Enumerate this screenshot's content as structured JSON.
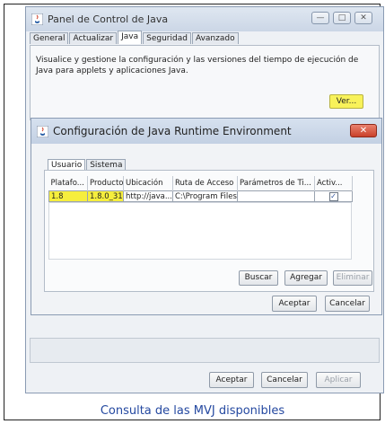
{
  "window": {
    "title": "Panel de Control de Java",
    "minimize": "—",
    "maximize": "□",
    "close": "✕"
  },
  "tabs": [
    {
      "label": "General",
      "active": false
    },
    {
      "label": "Actualizar",
      "active": false
    },
    {
      "label": "Java",
      "active": true
    },
    {
      "label": "Seguridad",
      "active": false
    },
    {
      "label": "Avanzado",
      "active": false
    }
  ],
  "java_panel": {
    "description": "Visualice y gestione la configuración y las versiones del tiempo de ejecución de Java para applets y aplicaciones Java.",
    "view_button": "Ver..."
  },
  "dialog": {
    "title": "Configuración de Java Runtime Environment",
    "close": "✕",
    "tabs": [
      {
        "label": "Usuario",
        "active": true
      },
      {
        "label": "Sistema",
        "active": false
      }
    ],
    "columns": [
      "Platafo...",
      "Producto",
      "Ubicación",
      "Ruta de Acceso",
      "Parámetros de Ti...",
      "Activ..."
    ],
    "rows": [
      {
        "platform": "1.8",
        "product": "1.8.0_31",
        "location": "http://java....",
        "path": "C:\\Program Files\\...",
        "params": "",
        "enabled": "✓"
      }
    ],
    "buttons": {
      "search": "Buscar",
      "add": "Agregar",
      "remove": "Eliminar",
      "accept": "Aceptar",
      "cancel": "Cancelar"
    }
  },
  "footer_buttons": {
    "accept": "Aceptar",
    "cancel": "Cancelar",
    "apply": "Aplicar"
  },
  "caption": "Consulta de las MVJ disponibles",
  "colors": {
    "highlight": "#f6ee3d",
    "caption": "#2448a0",
    "close_red": "#c9402a"
  },
  "icons": {
    "java_icon": "java-cup"
  }
}
